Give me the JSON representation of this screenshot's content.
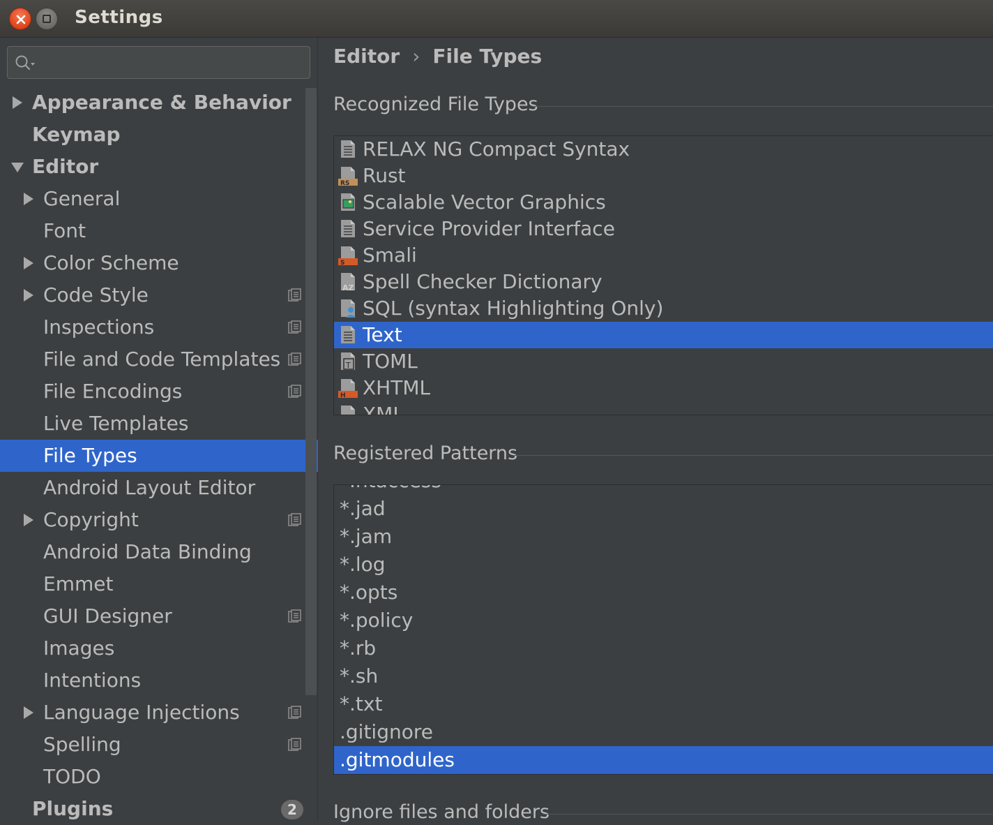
{
  "window": {
    "title": "Settings",
    "close_icon": "close-icon",
    "maximize_icon": "maximize-icon"
  },
  "search": {
    "placeholder": "",
    "value": ""
  },
  "sidebar": {
    "items": [
      {
        "label": "Appearance & Behavior",
        "level": 0,
        "arrow": "right",
        "bold": true,
        "project": false
      },
      {
        "label": "Keymap",
        "level": 0,
        "arrow": "none",
        "bold": true,
        "project": false
      },
      {
        "label": "Editor",
        "level": 0,
        "arrow": "down",
        "bold": true,
        "project": false
      },
      {
        "label": "General",
        "level": 1,
        "arrow": "right",
        "bold": false,
        "project": false
      },
      {
        "label": "Font",
        "level": 1,
        "arrow": "none",
        "bold": false,
        "project": false
      },
      {
        "label": "Color Scheme",
        "level": 1,
        "arrow": "right",
        "bold": false,
        "project": false
      },
      {
        "label": "Code Style",
        "level": 1,
        "arrow": "right",
        "bold": false,
        "project": true
      },
      {
        "label": "Inspections",
        "level": 1,
        "arrow": "none",
        "bold": false,
        "project": true
      },
      {
        "label": "File and Code Templates",
        "level": 1,
        "arrow": "none",
        "bold": false,
        "project": true
      },
      {
        "label": "File Encodings",
        "level": 1,
        "arrow": "none",
        "bold": false,
        "project": true
      },
      {
        "label": "Live Templates",
        "level": 1,
        "arrow": "none",
        "bold": false,
        "project": false
      },
      {
        "label": "File Types",
        "level": 1,
        "arrow": "none",
        "bold": false,
        "project": false,
        "selected": true
      },
      {
        "label": "Android Layout Editor",
        "level": 1,
        "arrow": "none",
        "bold": false,
        "project": false
      },
      {
        "label": "Copyright",
        "level": 1,
        "arrow": "right",
        "bold": false,
        "project": true
      },
      {
        "label": "Android Data Binding",
        "level": 1,
        "arrow": "none",
        "bold": false,
        "project": false
      },
      {
        "label": "Emmet",
        "level": 1,
        "arrow": "none",
        "bold": false,
        "project": false
      },
      {
        "label": "GUI Designer",
        "level": 1,
        "arrow": "none",
        "bold": false,
        "project": true
      },
      {
        "label": "Images",
        "level": 1,
        "arrow": "none",
        "bold": false,
        "project": false
      },
      {
        "label": "Intentions",
        "level": 1,
        "arrow": "none",
        "bold": false,
        "project": false
      },
      {
        "label": "Language Injections",
        "level": 1,
        "arrow": "right",
        "bold": false,
        "project": true
      },
      {
        "label": "Spelling",
        "level": 1,
        "arrow": "none",
        "bold": false,
        "project": true
      },
      {
        "label": "TODO",
        "level": 1,
        "arrow": "none",
        "bold": false,
        "project": false
      },
      {
        "label": "Plugins",
        "level": 0,
        "arrow": "none",
        "bold": true,
        "project": false,
        "badge": "2"
      }
    ]
  },
  "breadcrumb": {
    "parent": "Editor",
    "separator": "›",
    "current": "File Types"
  },
  "recognized": {
    "title": "Recognized File Types",
    "items": [
      {
        "label": "RELAX NG Compact Syntax",
        "icon": "text-file-icon"
      },
      {
        "label": "Rust",
        "icon": "rust-file-icon"
      },
      {
        "label": "Scalable Vector Graphics",
        "icon": "image-file-icon"
      },
      {
        "label": "Service Provider Interface",
        "icon": "text-file-icon"
      },
      {
        "label": "Smali",
        "icon": "smali-file-icon"
      },
      {
        "label": "Spell Checker Dictionary",
        "icon": "dictionary-file-icon"
      },
      {
        "label": "SQL (syntax Highlighting Only)",
        "icon": "sql-file-icon"
      },
      {
        "label": "Text",
        "icon": "text-file-icon",
        "selected": true
      },
      {
        "label": "TOML",
        "icon": "toml-file-icon"
      },
      {
        "label": "XHTML",
        "icon": "xhtml-file-icon"
      },
      {
        "label": "XML",
        "icon": "xml-file-icon"
      }
    ]
  },
  "patterns": {
    "title": "Registered Patterns",
    "items": [
      {
        "label": "*.htaccess"
      },
      {
        "label": "*.jad"
      },
      {
        "label": "*.jam"
      },
      {
        "label": "*.log"
      },
      {
        "label": "*.opts"
      },
      {
        "label": "*.policy"
      },
      {
        "label": "*.rb"
      },
      {
        "label": "*.sh"
      },
      {
        "label": "*.txt"
      },
      {
        "label": ".gitignore"
      },
      {
        "label": ".gitmodules",
        "selected": true
      }
    ]
  },
  "ignore": {
    "title": "Ignore files and folders"
  },
  "colors": {
    "selection": "#2f65ca",
    "background": "#3c3f41",
    "text": "#bbbbbb"
  }
}
